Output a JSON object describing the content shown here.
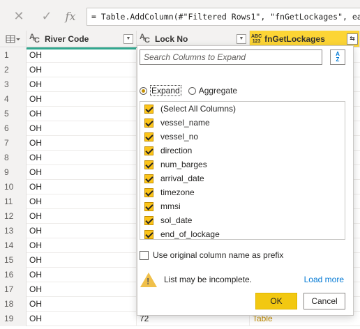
{
  "formula_bar": {
    "formula": "= Table.AddColumn(#\"Filtered Rows1\", \"fnGetLockages\", each"
  },
  "columns": [
    {
      "type_icon": "ABC",
      "label": "River Code"
    },
    {
      "type_icon": "ABC",
      "label": "Lock No"
    },
    {
      "type_icon": "ABC 123",
      "label": "fnGetLockages"
    }
  ],
  "rows": [
    {
      "num": "1",
      "river": "OH",
      "lock": "",
      "result": ""
    },
    {
      "num": "2",
      "river": "OH",
      "lock": "",
      "result": ""
    },
    {
      "num": "3",
      "river": "OH",
      "lock": "",
      "result": ""
    },
    {
      "num": "4",
      "river": "OH",
      "lock": "",
      "result": ""
    },
    {
      "num": "5",
      "river": "OH",
      "lock": "",
      "result": ""
    },
    {
      "num": "6",
      "river": "OH",
      "lock": "",
      "result": ""
    },
    {
      "num": "7",
      "river": "OH",
      "lock": "",
      "result": ""
    },
    {
      "num": "8",
      "river": "OH",
      "lock": "",
      "result": ""
    },
    {
      "num": "9",
      "river": "OH",
      "lock": "",
      "result": ""
    },
    {
      "num": "10",
      "river": "OH",
      "lock": "",
      "result": ""
    },
    {
      "num": "11",
      "river": "OH",
      "lock": "",
      "result": ""
    },
    {
      "num": "12",
      "river": "OH",
      "lock": "",
      "result": ""
    },
    {
      "num": "13",
      "river": "OH",
      "lock": "",
      "result": ""
    },
    {
      "num": "14",
      "river": "OH",
      "lock": "",
      "result": ""
    },
    {
      "num": "15",
      "river": "OH",
      "lock": "",
      "result": ""
    },
    {
      "num": "16",
      "river": "OH",
      "lock": "",
      "result": ""
    },
    {
      "num": "17",
      "river": "OH",
      "lock": "",
      "result": ""
    },
    {
      "num": "18",
      "river": "OH",
      "lock": "",
      "result": ""
    },
    {
      "num": "19",
      "river": "OH",
      "lock": "72",
      "result": "Table"
    }
  ],
  "expand_popup": {
    "search_placeholder": "Search Columns to Expand",
    "mode_expand": "Expand",
    "mode_aggregate": "Aggregate",
    "selected_mode": "Expand",
    "columns": [
      {
        "label": "(Select All Columns)",
        "checked": true
      },
      {
        "label": "vessel_name",
        "checked": true
      },
      {
        "label": "vessel_no",
        "checked": true
      },
      {
        "label": "direction",
        "checked": true
      },
      {
        "label": "num_barges",
        "checked": true
      },
      {
        "label": "arrival_date",
        "checked": true
      },
      {
        "label": "timezone",
        "checked": true
      },
      {
        "label": "mmsi",
        "checked": true
      },
      {
        "label": "sol_date",
        "checked": true
      },
      {
        "label": "end_of_lockage",
        "checked": true
      }
    ],
    "prefix_label": "Use original column name as prefix",
    "prefix_checked": false,
    "warning_text": "List may be incomplete.",
    "load_more": "Load more",
    "ok": "OK",
    "cancel": "Cancel"
  },
  "colors": {
    "accent": "#f2c811",
    "checkbox": "#fcc419",
    "link": "#0078d4",
    "quality_bar": "#31a88f",
    "table_link": "#c38e00"
  }
}
